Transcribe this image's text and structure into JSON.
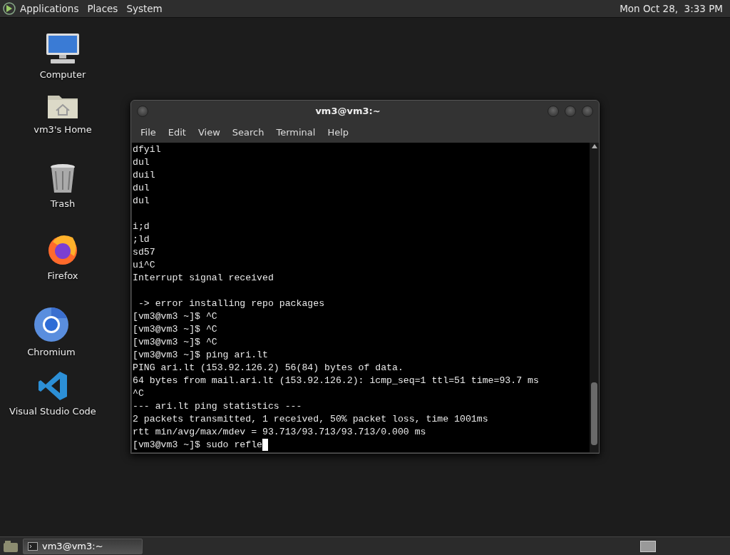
{
  "top_panel": {
    "menus": [
      "Applications",
      "Places",
      "System"
    ],
    "clock": "Mon Oct 28,  3:33 PM"
  },
  "desktop_icons": [
    {
      "kind": "computer",
      "label": "Computer"
    },
    {
      "kind": "home",
      "label": "vm3's Home"
    },
    {
      "kind": "trash",
      "label": "Trash"
    },
    {
      "kind": "firefox",
      "label": "Firefox"
    },
    {
      "kind": "chromium",
      "label": "Chromium"
    },
    {
      "kind": "vscode",
      "label": "Visual Studio Code"
    }
  ],
  "window": {
    "title": "vm3@vm3:~",
    "menu": [
      "File",
      "Edit",
      "View",
      "Search",
      "Terminal",
      "Help"
    ],
    "terminal": {
      "blocks": [
        [
          "dfyil",
          "dul",
          "duil",
          "dul",
          "dul"
        ],
        [
          "i;d",
          ";ld",
          "sd57",
          "ui^C",
          "Interrupt signal received"
        ],
        [
          " -> error installing repo packages",
          "[vm3@vm3 ~]$ ^C",
          "[vm3@vm3 ~]$ ^C",
          "[vm3@vm3 ~]$ ^C",
          "[vm3@vm3 ~]$ ping ari.lt",
          "PING ari.lt (153.92.126.2) 56(84) bytes of data.",
          "64 bytes from mail.ari.lt (153.92.126.2): icmp_seq=1 ttl=51 time=93.7 ms",
          "^C",
          "--- ari.lt ping statistics ---",
          "2 packets transmitted, 1 received, 50% packet loss, time 1001ms",
          "rtt min/avg/max/mdev = 93.713/93.713/93.713/0.000 ms",
          "[vm3@vm3 ~]$ sudo refle"
        ]
      ]
    }
  },
  "taskbar": {
    "tasks": [
      {
        "label": "vm3@vm3:~",
        "selected": true
      }
    ]
  }
}
